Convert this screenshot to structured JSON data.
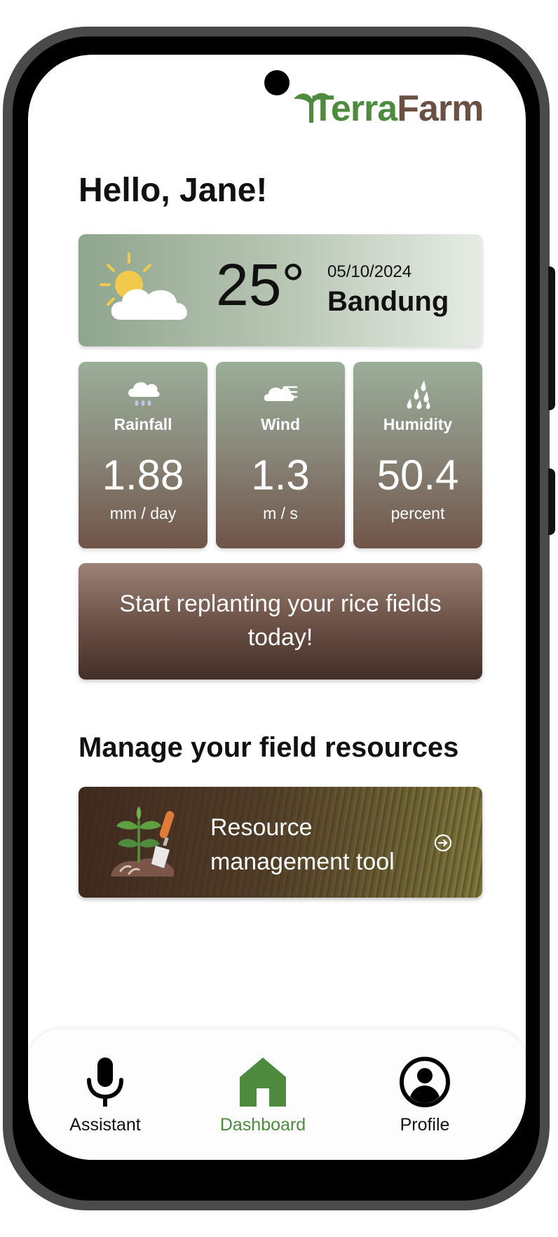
{
  "app": {
    "logo": {
      "part1": "Terra",
      "part2": "Farm"
    },
    "brand_colors": {
      "green": "#4e8b3e",
      "brown": "#6b5044"
    }
  },
  "greeting": "Hello, Jane!",
  "weather": {
    "icon": "partly-cloudy-icon",
    "temperature": "25°",
    "date": "05/10/2024",
    "city": "Bandung"
  },
  "stats": [
    {
      "icon": "rain-cloud-icon",
      "label": "Rainfall",
      "value": "1.88",
      "unit": "mm / day"
    },
    {
      "icon": "wind-cloud-icon",
      "label": "Wind",
      "value": "1.3",
      "unit": "m / s"
    },
    {
      "icon": "humidity-drops-icon",
      "label": "Humidity",
      "value": "50.4",
      "unit": "percent"
    }
  ],
  "cta": {
    "text": "Start replanting your rice fields today!"
  },
  "section": {
    "title": "Manage your field resources"
  },
  "resource_card": {
    "icon": "plant-shovel-icon",
    "label": "Resource management tool",
    "arrow_icon": "arrow-circle-right-icon"
  },
  "bottom_nav": {
    "active": "Dashboard",
    "items": [
      {
        "label": "Assistant",
        "icon": "microphone-icon"
      },
      {
        "label": "Dashboard",
        "icon": "home-icon"
      },
      {
        "label": "Profile",
        "icon": "profile-icon"
      }
    ]
  }
}
